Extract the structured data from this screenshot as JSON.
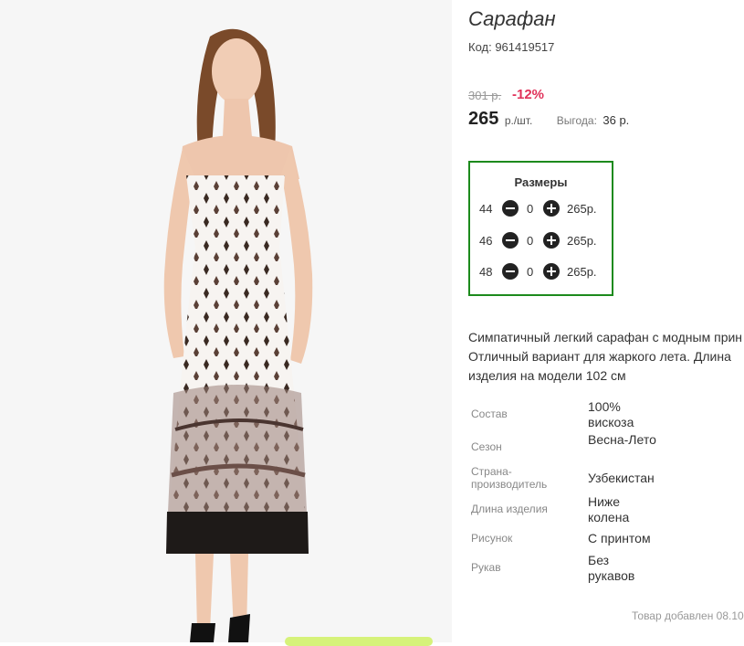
{
  "product": {
    "title": "Сарафан",
    "sku": "Код: 961419517",
    "old_price": "301 р.",
    "discount": "-12%",
    "price": "265",
    "price_unit": "р./шт.",
    "savings_label": "Выгода:",
    "savings_value": "36 р."
  },
  "sizes": {
    "title": "Размеры",
    "rows": [
      {
        "size": "44",
        "qty": "0",
        "price": "265р."
      },
      {
        "size": "46",
        "qty": "0",
        "price": "265р."
      },
      {
        "size": "48",
        "qty": "0",
        "price": "265р."
      }
    ],
    "border_color": "#1c8a1c"
  },
  "description": {
    "lines": [
      "Симпатичный легкий сарафан с модным прин",
      "Отличный вариант для жаркого лета. Длина",
      "изделия на модели 102 см"
    ]
  },
  "specs": [
    {
      "label": "Состав",
      "value": "100% вискоза"
    },
    {
      "label": "Сезон",
      "value": "Весна-Лето"
    },
    {
      "label": "Страна-производитель",
      "value": "Узбекистан"
    },
    {
      "label": "Длина изделия",
      "value": "Ниже колена"
    },
    {
      "label": "Рисунок",
      "value": "С принтом"
    },
    {
      "label": "Рукав",
      "value": "Без рукавов"
    }
  ],
  "added": "Товар добавлен 08.10",
  "colors": {
    "discount": "#e0325a",
    "accent_green": "#d6f27a"
  },
  "icons": {
    "minus": "minus-circle-icon",
    "plus": "plus-circle-icon"
  }
}
